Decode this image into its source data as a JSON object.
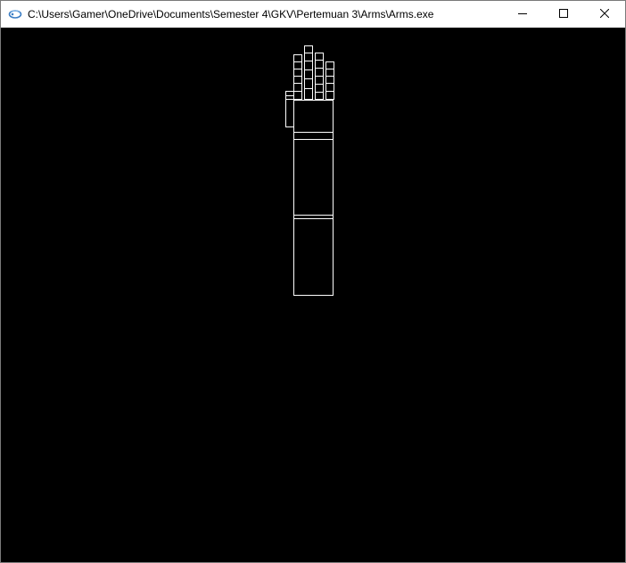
{
  "window": {
    "title": "C:\\Users\\Gamer\\OneDrive\\Documents\\Semester 4\\GKV\\Pertemuan 3\\Arms\\Arms.exe",
    "app_icon": "opengl-app-icon",
    "background_color": "#000000",
    "caption_buttons": {
      "minimize": "minimize-icon",
      "maximize": "maximize-icon",
      "close": "close-icon"
    }
  },
  "scene": {
    "wire_color": "#ffffff",
    "parts": [
      "upper-arm",
      "forearm",
      "palm",
      "thumb",
      "finger-1",
      "finger-2",
      "finger-3",
      "finger-4"
    ]
  }
}
